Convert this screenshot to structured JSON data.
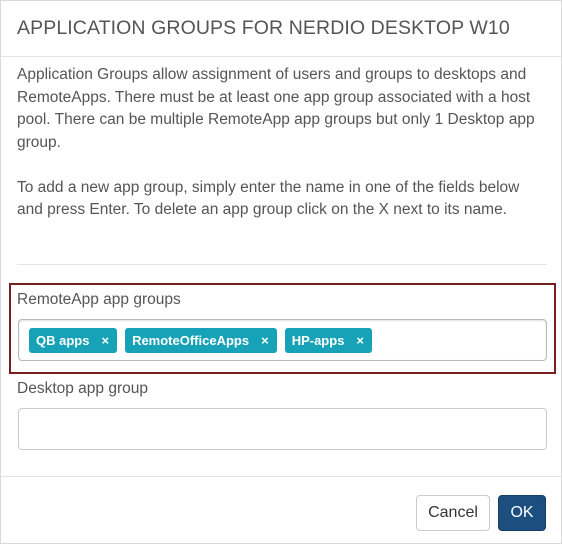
{
  "dialog": {
    "title": "APPLICATION GROUPS FOR NERDIO DESKTOP W10",
    "description_p1": "Application Groups allow assignment of users and groups to desktops and RemoteApps. There must be at least one app group associated with a host pool. There can be multiple RemoteApp app groups but only 1 Desktop app group.",
    "description_p2": "To add a new app group, simply enter the name in one of the fields below and press Enter. To delete an app group click on the X next to its name."
  },
  "remote_groups": {
    "label": "RemoteApp app groups",
    "tags": [
      {
        "label": "QB apps",
        "remove_icon": "×"
      },
      {
        "label": "RemoteOfficeApps",
        "remove_icon": "×"
      },
      {
        "label": "HP-apps",
        "remove_icon": "×"
      }
    ]
  },
  "desktop_group": {
    "label": "Desktop app group",
    "value": ""
  },
  "footer": {
    "cancel_label": "Cancel",
    "ok_label": "OK"
  },
  "colors": {
    "tag_bg": "#17a2b8",
    "ok_bg": "#1c4e80",
    "highlight_border": "#7a1f1f"
  },
  "icons": {
    "tag_remove": "close-icon"
  }
}
